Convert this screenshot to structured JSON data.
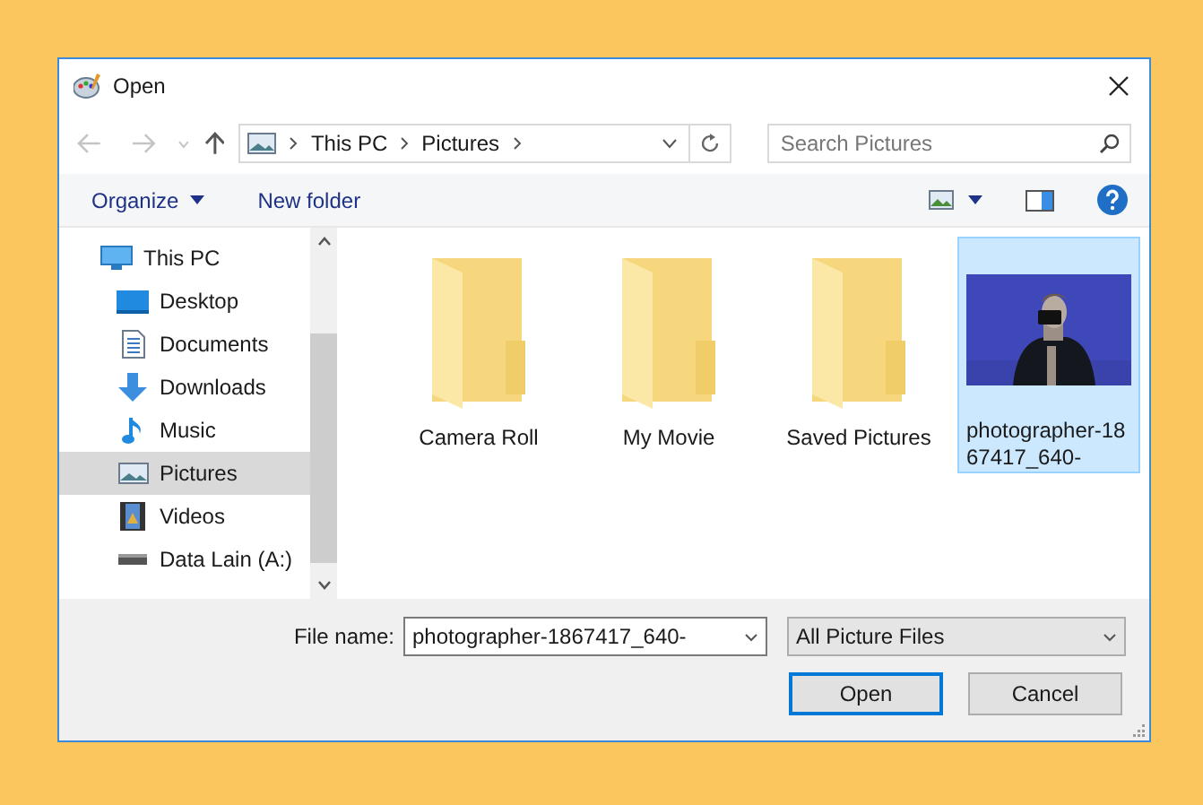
{
  "window": {
    "title": "Open"
  },
  "address": {
    "crumbs": [
      "This PC",
      "Pictures"
    ]
  },
  "search": {
    "placeholder": "Search Pictures"
  },
  "toolbar": {
    "organize": "Organize",
    "new_folder": "New folder"
  },
  "sidebar": {
    "items": [
      {
        "label": "This PC",
        "kind": "pc",
        "selected": false,
        "children": [
          {
            "label": "Desktop",
            "kind": "desktop",
            "selected": false
          },
          {
            "label": "Documents",
            "kind": "documents",
            "selected": false
          },
          {
            "label": "Downloads",
            "kind": "downloads",
            "selected": false
          },
          {
            "label": "Music",
            "kind": "music",
            "selected": false
          },
          {
            "label": "Pictures",
            "kind": "pictures",
            "selected": true
          },
          {
            "label": "Videos",
            "kind": "videos",
            "selected": false
          },
          {
            "label": "Data Lain (A:)",
            "kind": "drive",
            "selected": false
          }
        ]
      }
    ]
  },
  "files": [
    {
      "name": "Camera Roll",
      "kind": "folder",
      "selected": false
    },
    {
      "name": "My Movie",
      "kind": "folder",
      "selected": false
    },
    {
      "name": "Saved Pictures",
      "kind": "folder",
      "selected": false
    },
    {
      "name": "photographer-1867417_640-",
      "kind": "picture",
      "selected": true
    }
  ],
  "file_name": {
    "label": "File name:",
    "value": "photographer-1867417_640-"
  },
  "file_type": {
    "value": "All Picture Files"
  },
  "buttons": [
    {
      "label": "Open",
      "kind": "primary"
    },
    {
      "label": "Cancel",
      "kind": "normal"
    }
  ]
}
